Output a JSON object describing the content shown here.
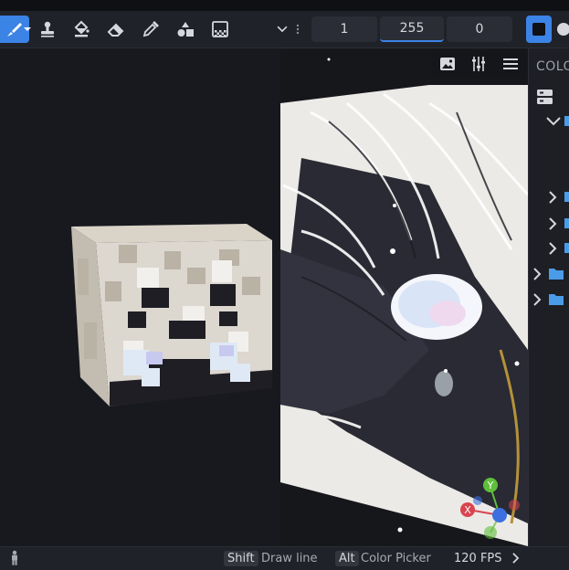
{
  "toolbar": {
    "fields": [
      "1",
      "255",
      "0"
    ]
  },
  "side_panel": {
    "title": "COLO"
  },
  "status": {
    "shift_key": "Shift",
    "shift_action": "Draw line",
    "alt_key": "Alt",
    "alt_action": "Color Picker",
    "fps": "120 FPS"
  },
  "gizmo": {
    "y": "Y",
    "x": "X"
  },
  "colors": {
    "accent": "#3c83e6",
    "toolbar_bg": "#202229",
    "viewport_bg": "#18191e",
    "axis_x": "#d9454f",
    "axis_y": "#5fbf3a",
    "axis_z": "#3c6fe0"
  },
  "icons": [
    "brush-icon",
    "stamp-icon",
    "fill-bucket-icon",
    "eraser-icon",
    "eyedropper-icon",
    "shapes-icon",
    "gradient-icon",
    "chevron-down-icon",
    "more-icon",
    "image-icon",
    "adjust-icon",
    "menu-icon",
    "folder-icon",
    "person-icon"
  ]
}
